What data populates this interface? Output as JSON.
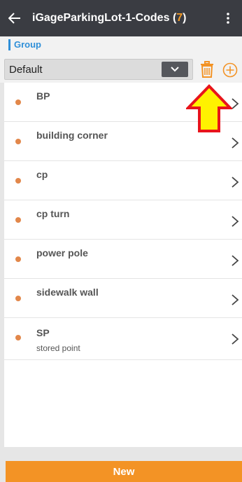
{
  "header": {
    "back_icon": "arrow-left-icon",
    "title": "iGageParkingLot-1-Codes",
    "count_open": "(",
    "count": "7",
    "count_close": ")",
    "menu_icon": "more-vertical-icon"
  },
  "group": {
    "label": "Group",
    "selected": "Default",
    "dropdown_icon": "chevron-down-icon",
    "delete_icon": "trash-icon",
    "add_icon": "plus-circle-icon"
  },
  "codes": [
    {
      "name": "BP",
      "description": ""
    },
    {
      "name": "building corner",
      "description": ""
    },
    {
      "name": "cp",
      "description": ""
    },
    {
      "name": "cp turn",
      "description": ""
    },
    {
      "name": "power pole",
      "description": ""
    },
    {
      "name": "sidewalk wall",
      "description": ""
    },
    {
      "name": "SP",
      "description": "stored point"
    }
  ],
  "footer": {
    "new_label": "New"
  },
  "colors": {
    "accent": "#f39325",
    "header_bg": "#3a3c42",
    "group_label": "#2f8fd8",
    "dot": "#e2874a",
    "annotation_arrow_fill": "#fff200",
    "annotation_arrow_stroke": "#e8141b"
  }
}
